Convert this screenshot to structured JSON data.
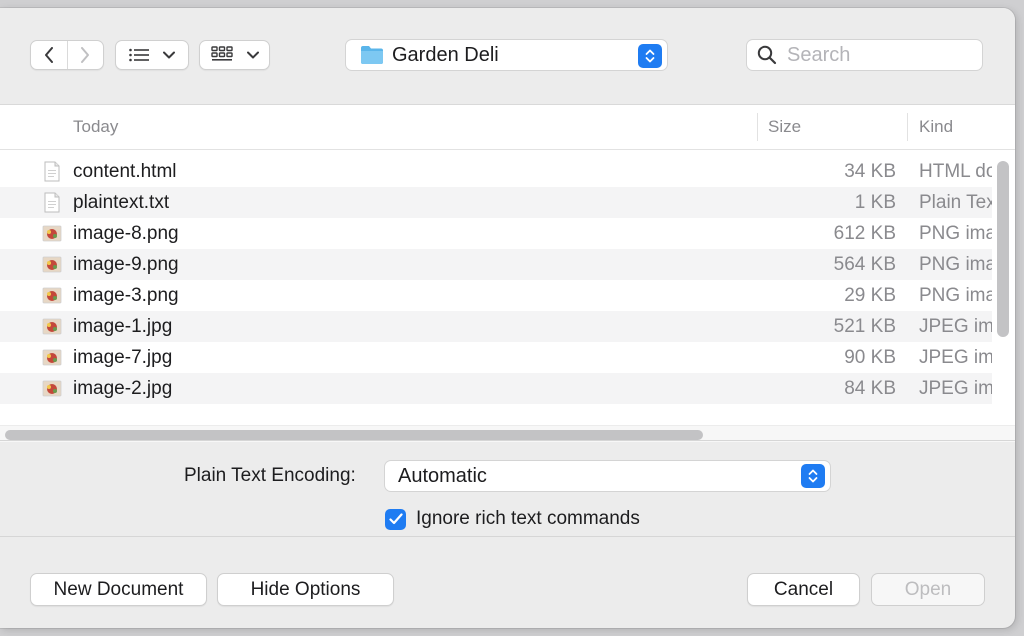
{
  "location": {
    "folder": "Garden Deli"
  },
  "search": {
    "placeholder": "Search"
  },
  "columns": {
    "name": "Today",
    "size": "Size",
    "kind": "Kind"
  },
  "files": [
    {
      "name": "content.html",
      "size": "34 KB",
      "kind": "HTML do",
      "icon": "document-icon"
    },
    {
      "name": "plaintext.txt",
      "size": "1 KB",
      "kind": "Plain Tex",
      "icon": "document-icon"
    },
    {
      "name": "image-8.png",
      "size": "612 KB",
      "kind": "PNG ima",
      "icon": "image-thumbnail-icon"
    },
    {
      "name": "image-9.png",
      "size": "564 KB",
      "kind": "PNG ima",
      "icon": "image-thumbnail-icon"
    },
    {
      "name": "image-3.png",
      "size": "29 KB",
      "kind": "PNG ima",
      "icon": "image-thumbnail-icon"
    },
    {
      "name": "image-1.jpg",
      "size": "521 KB",
      "kind": "JPEG im",
      "icon": "image-thumbnail-icon"
    },
    {
      "name": "image-7.jpg",
      "size": "90 KB",
      "kind": "JPEG im",
      "icon": "image-thumbnail-icon"
    },
    {
      "name": "image-2.jpg",
      "size": "84 KB",
      "kind": "JPEG im",
      "icon": "image-thumbnail-icon"
    }
  ],
  "options": {
    "encoding_label": "Plain Text Encoding:",
    "encoding_value": "Automatic",
    "ignore_rich_label": "Ignore rich text commands",
    "ignore_rich_checked": true
  },
  "buttons": {
    "new_document": "New Document",
    "hide_options": "Hide Options",
    "cancel": "Cancel",
    "open": "Open"
  },
  "colors": {
    "accent": "#1f7cf2"
  }
}
